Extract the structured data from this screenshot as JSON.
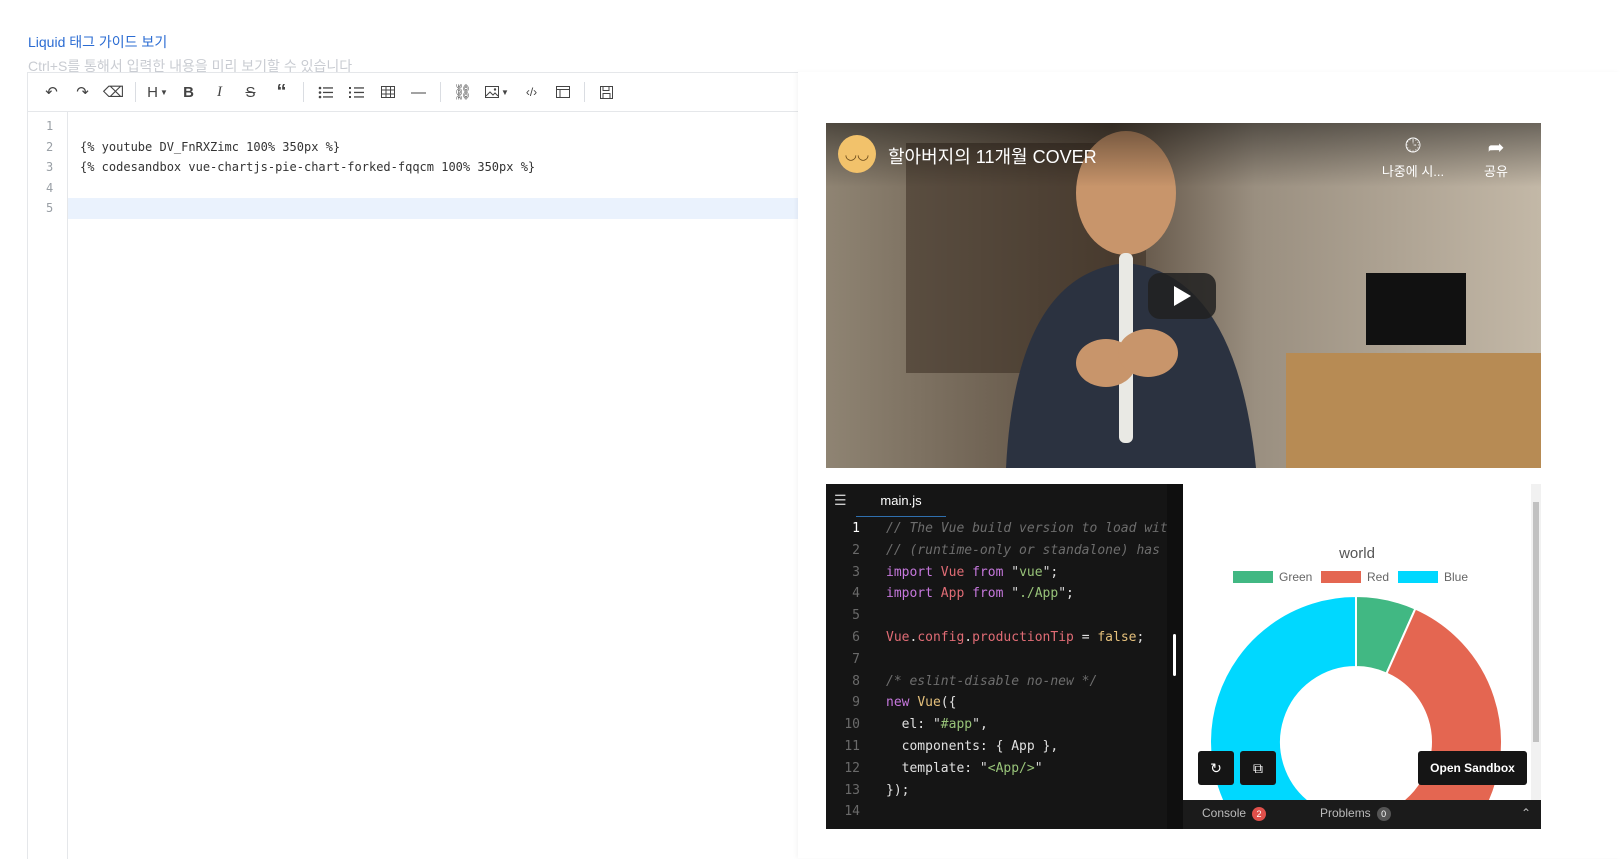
{
  "guide_link": "Liquid 태그 가이드 보기",
  "hint": "Ctrl+S를 통해서 입력한 내용을 미리 보기할 수 있습니다",
  "toolbar": {
    "heading_label": "H",
    "bold_label": "B",
    "italic_label": "I",
    "strike_label": "S"
  },
  "editor": {
    "line_numbers": [
      "1",
      "2",
      "3",
      "4",
      "5"
    ],
    "lines": [
      "",
      "{% youtube DV_FnRXZimc 100% 350px %}",
      "{% codesandbox vue-chartjs-pie-chart-forked-fqqcm 100% 350px %}",
      "",
      ""
    ]
  },
  "youtube": {
    "title": "할아버지의 11개월 COVER",
    "watch_later": "나중에 시...",
    "share": "공유"
  },
  "codesandbox": {
    "tab": "main.js",
    "line_numbers": [
      "1",
      "2",
      "3",
      "4",
      "5",
      "6",
      "7",
      "8",
      "9",
      "10",
      "11",
      "12",
      "13",
      "14"
    ],
    "chart_title": "world",
    "legend": [
      {
        "name": "Green",
        "color": "#41b883"
      },
      {
        "name": "Red",
        "color": "#e46651"
      },
      {
        "name": "Blue",
        "color": "#00d8ff"
      }
    ],
    "open_sandbox": "Open Sandbox",
    "console_label": "Console",
    "console_count": "2",
    "problems_label": "Problems",
    "problems_count": "0"
  },
  "chart_data": {
    "type": "pie",
    "title": "world",
    "categories": [
      "Green",
      "Red",
      "Blue"
    ],
    "values": [
      5,
      40,
      30
    ],
    "colors": [
      "#41b883",
      "#e46651",
      "#00d8ff"
    ],
    "legend": "top",
    "doughnut": true
  }
}
